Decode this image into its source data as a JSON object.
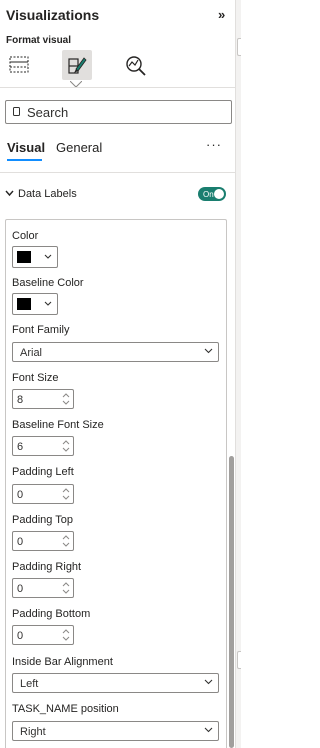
{
  "pane": {
    "title": "Visualizations",
    "collapse_icon": "chevron-double-right-icon",
    "subtitle": "Format visual"
  },
  "icons": [
    {
      "name": "build-visual-icon",
      "active": false
    },
    {
      "name": "format-visual-icon",
      "active": true
    },
    {
      "name": "analytics-icon",
      "active": false
    }
  ],
  "search": {
    "placeholder": "Search",
    "icon": "search-icon"
  },
  "tabs": [
    {
      "label": "Visual",
      "selected": true
    },
    {
      "label": "General",
      "selected": false
    }
  ],
  "more_label": "···",
  "section": {
    "label": "Data Labels",
    "expanded": true,
    "toggle_label": "On",
    "toggle_color": "#1a7e6f"
  },
  "properties": {
    "color": {
      "label": "Color",
      "value": "#000000"
    },
    "baseline_color": {
      "label": "Baseline Color",
      "value": "#000000"
    },
    "font_family": {
      "label": "Font Family",
      "value": "Arial"
    },
    "font_size": {
      "label": "Font Size",
      "value": "8"
    },
    "baseline_font_size": {
      "label": "Baseline Font Size",
      "value": "6"
    },
    "padding_left": {
      "label": "Padding Left",
      "value": "0"
    },
    "padding_top": {
      "label": "Padding Top",
      "value": "0"
    },
    "padding_right": {
      "label": "Padding Right",
      "value": "0"
    },
    "padding_bottom": {
      "label": "Padding Bottom",
      "value": "0"
    },
    "inside_bar_alignment": {
      "label": "Inside Bar Alignment",
      "value": "Left"
    },
    "task_name_position": {
      "label": "TASK_NAME position",
      "value": "Right"
    }
  }
}
